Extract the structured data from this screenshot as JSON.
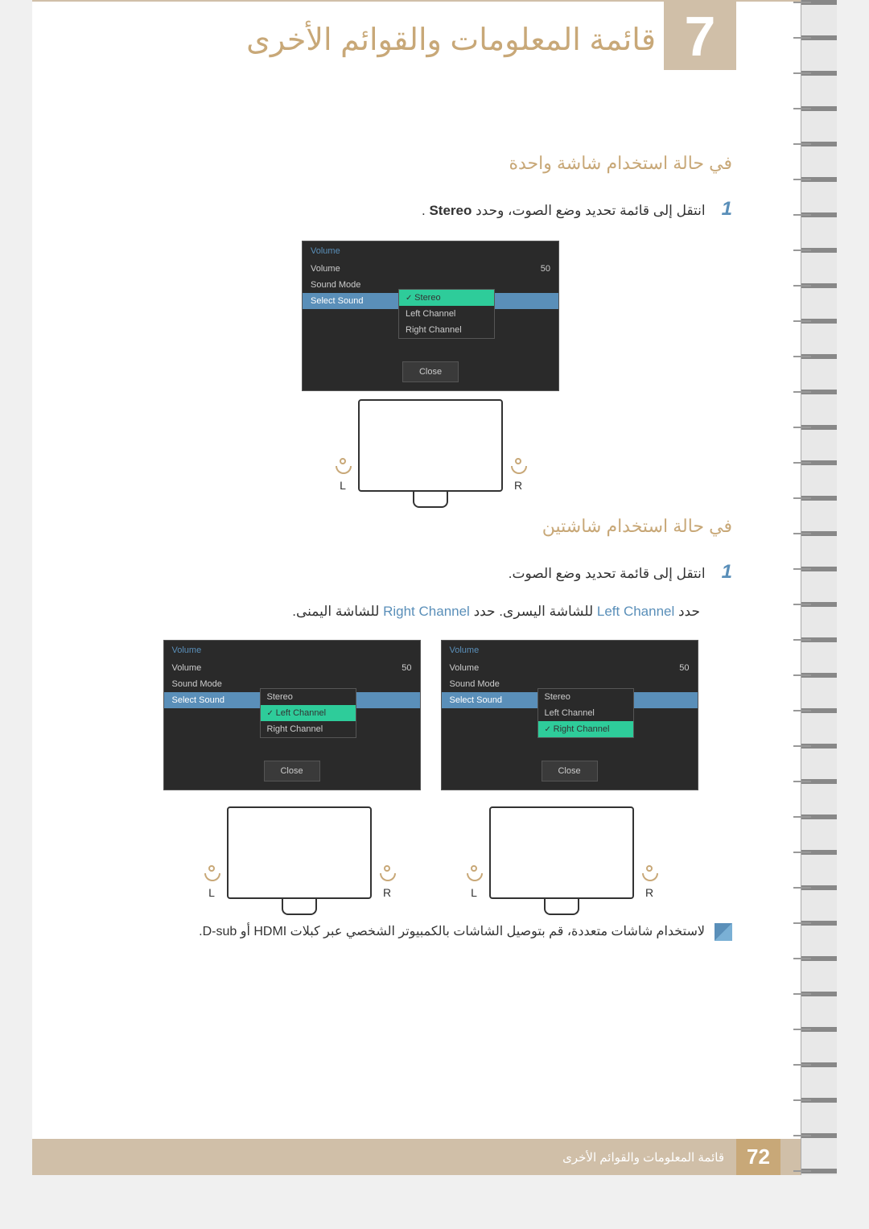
{
  "header": {
    "chapter_number": "7",
    "chapter_title": "قائمة المعلومات والقوائم الأخرى"
  },
  "section1": {
    "title": "في حالة استخدام شاشة واحدة",
    "step_num": "1",
    "step_text_prefix": "انتقل إلى قائمة تحديد وضع الصوت، وحدد ",
    "step_text_bold": "Stereo",
    "step_text_suffix": " ."
  },
  "osd1": {
    "header": "Volume",
    "volume_label": "Volume",
    "volume_value": "50",
    "sound_mode": "Sound Mode",
    "select_sound": "Select Sound",
    "opt1": "Stereo",
    "opt2": "Left Channel",
    "opt3": "Right Channel",
    "close": "Close"
  },
  "speakers_single": {
    "left": "L",
    "right": "R"
  },
  "section2": {
    "title": "في حالة استخدام شاشتين",
    "step_num": "1",
    "step_text": "انتقل إلى قائمة تحديد وضع الصوت.",
    "desc_p1": "حدد ",
    "desc_left": "Left Channel",
    "desc_p2": " للشاشة اليسرى. حدد ",
    "desc_right": "Right Channel",
    "desc_p3": " للشاشة اليمنى."
  },
  "osd2L": {
    "header": "Volume",
    "volume_label": "Volume",
    "volume_value": "50",
    "sound_mode": "Sound Mode",
    "select_sound": "Select Sound",
    "opt1": "Stereo",
    "opt2": "Left Channel",
    "opt3": "Right Channel",
    "close": "Close"
  },
  "osd2R": {
    "header": "Volume",
    "volume_label": "Volume",
    "volume_value": "50",
    "sound_mode": "Sound Mode",
    "select_sound": "Select Sound",
    "opt1": "Stereo",
    "opt2": "Left Channel",
    "opt3": "Right Channel",
    "close": "Close"
  },
  "speakers_dual": {
    "l1": "L",
    "r1": "R",
    "l2": "L",
    "r2": "R"
  },
  "note": {
    "text": "لاستخدام شاشات متعددة، قم بتوصيل الشاشات بالكمبيوتر الشخصي عبر كبلات HDMI أو D-sub."
  },
  "footer": {
    "page_number": "72",
    "title": "قائمة المعلومات والقوائم الأخرى"
  }
}
